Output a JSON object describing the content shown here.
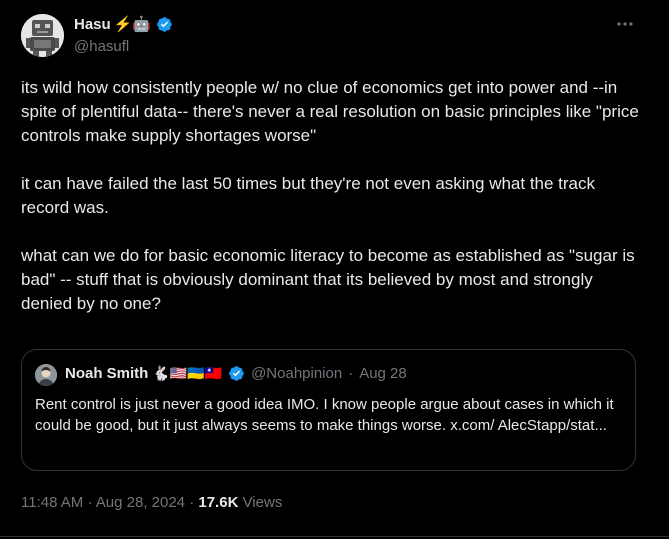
{
  "author": {
    "display_name": "Hasu",
    "emoji": "⚡🤖",
    "handle": "@hasufl"
  },
  "more_icon": "more-horizontal-icon",
  "tweet_text": "its wild how consistently people w/ no clue of economics get into power and --in spite of plentiful data-- there's never a real resolution on basic principles like \"price controls make supply shortages worse\"\n\nit can have failed the last 50 times but they're not even asking what the track record was.\n\nwhat can we do for basic economic literacy to become as established as \"sugar is bad\" -- stuff that is obviously dominant that its believed by most and strongly denied by no one?",
  "quote": {
    "display_name": "Noah Smith",
    "emoji": "🐇🇺🇸🇺🇦🇹🇼",
    "handle": "@Noahpinion",
    "separator": "·",
    "date": "Aug 28",
    "text": "Rent control is just never a good idea IMO. I know people argue about cases in which it could be good, but it just always seems to make things worse. x.com/ AlecStapp/stat..."
  },
  "meta": {
    "time": "11:48 AM",
    "sep1": "·",
    "date": "Aug 28, 2024",
    "sep2": "·",
    "views_count": "17.6K",
    "views_label": "Views"
  },
  "colors": {
    "background": "#000000",
    "text": "#e7e9ea",
    "muted": "#71767b",
    "verified": "#1d9bf0",
    "border": "#2f3336"
  }
}
